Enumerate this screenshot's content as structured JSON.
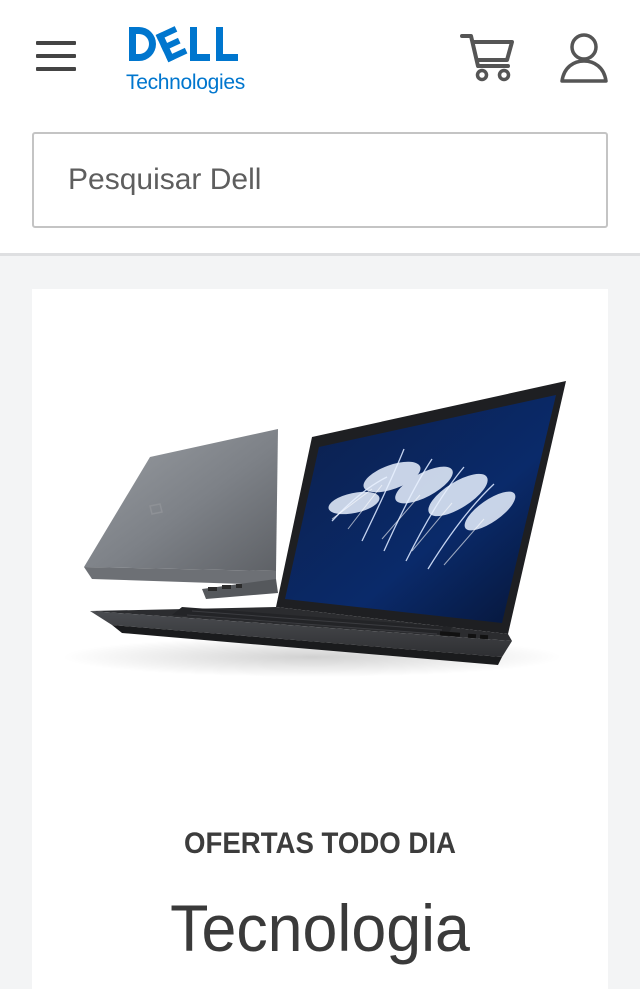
{
  "header": {
    "menu_icon": "hamburger-icon",
    "logo": {
      "word": "DELL",
      "sub": "Technologies"
    },
    "cart_icon": "cart-icon",
    "account_icon": "user-icon",
    "accent_color": "#0076ce"
  },
  "search": {
    "placeholder": "Pesquisar Dell",
    "value": ""
  },
  "promo": {
    "image": "laptop-product-image",
    "eyebrow": "OFERTAS TODO DIA",
    "headline": "Tecnologia"
  }
}
